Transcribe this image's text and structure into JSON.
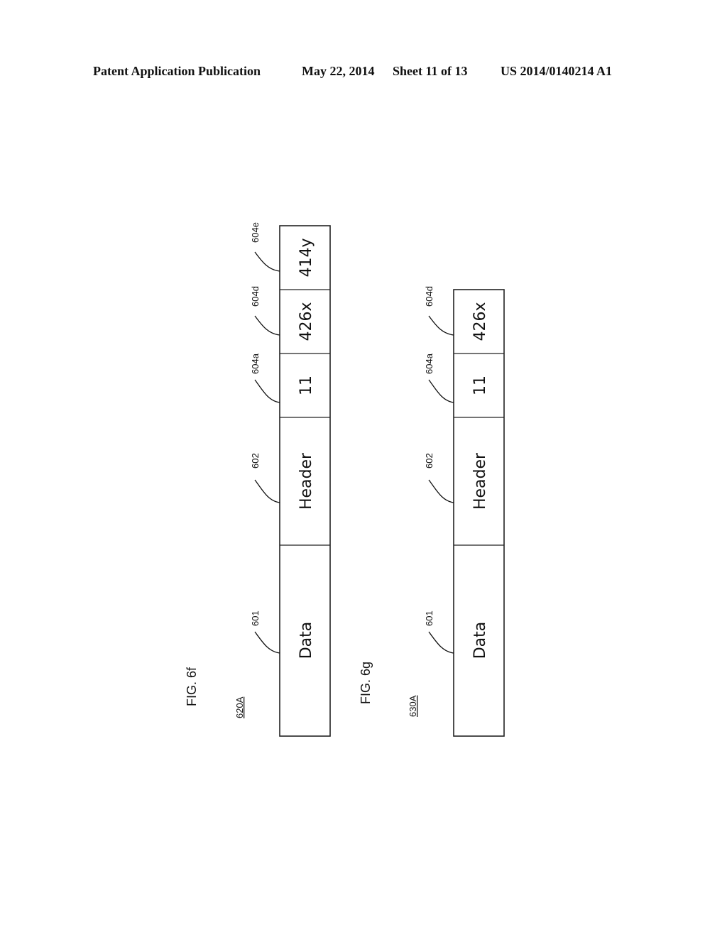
{
  "header": {
    "publication": "Patent Application Publication",
    "date": "May 22, 2014",
    "sheet": "Sheet 11 of 13",
    "number": "US 2014/0140214 A1"
  },
  "figures": [
    {
      "label": "FIG. 6f",
      "ref": "620A",
      "cells": [
        {
          "text": "Data",
          "ref": "601"
        },
        {
          "text": "Header",
          "ref": "602"
        },
        {
          "text": "11",
          "ref": "604a"
        },
        {
          "text": "426x",
          "ref": "604d"
        },
        {
          "text": "414y",
          "ref": "604e"
        }
      ]
    },
    {
      "label": "FIG. 6g",
      "ref": "630A",
      "cells": [
        {
          "text": "Data",
          "ref": "601"
        },
        {
          "text": "Header",
          "ref": "602"
        },
        {
          "text": "11",
          "ref": "604a"
        },
        {
          "text": "426x",
          "ref": "604d"
        }
      ]
    }
  ]
}
